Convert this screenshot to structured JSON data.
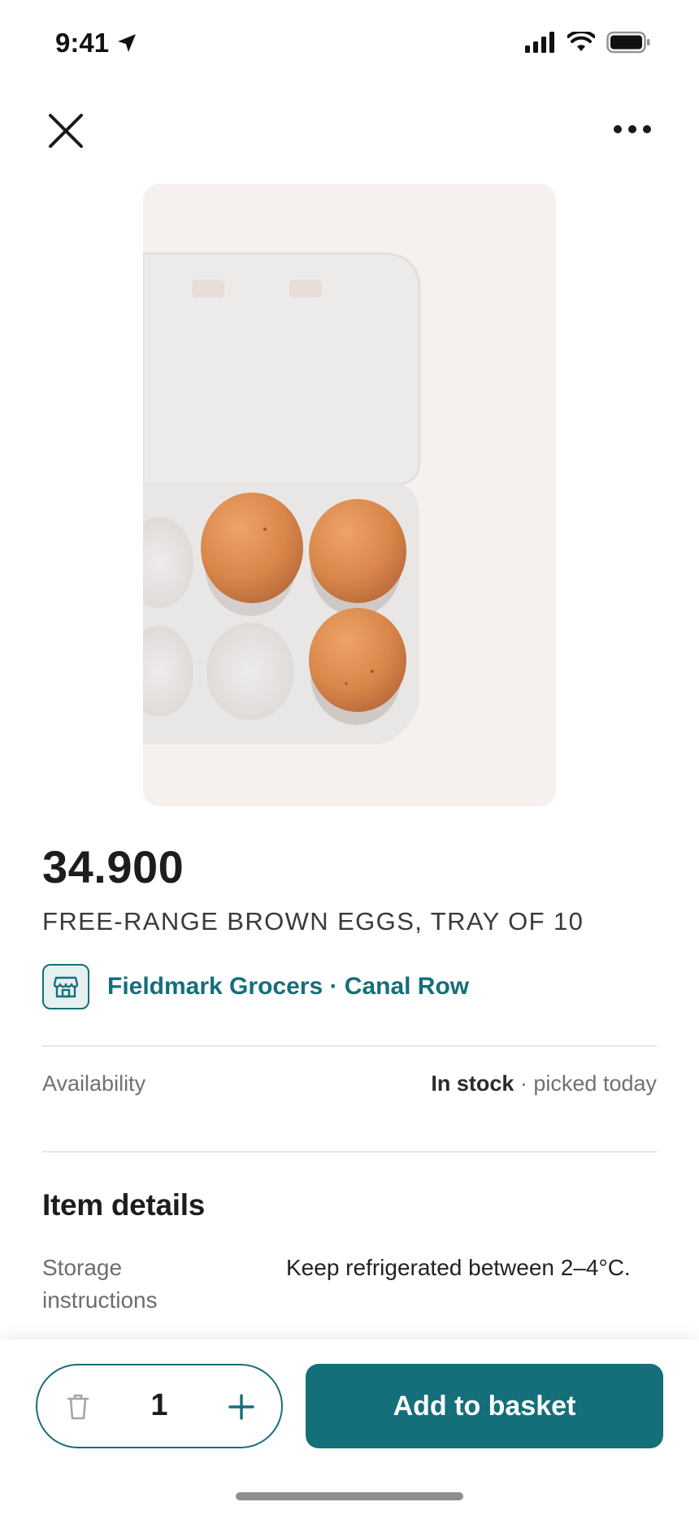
{
  "status_bar": {
    "time": "9:41"
  },
  "nav": {
    "close_icon": "close-icon",
    "more_icon": "more-horizontal-icon"
  },
  "product": {
    "image_subject": "egg carton",
    "price": "34.900",
    "title": "FREE-RANGE BROWN EGGS, TRAY OF 10",
    "store_name": "Fieldmark Grocers · Canal Row",
    "store_icon": "storefront-icon"
  },
  "availability": {
    "label": "Availability",
    "status": "In stock",
    "note": " · picked today"
  },
  "item_details": {
    "heading": "Item details",
    "rows": [
      {
        "key": "Storage instructions",
        "value": "Keep refrigerated between 2–4°C."
      }
    ]
  },
  "cart": {
    "quantity": "1",
    "delete_icon": "trash-icon",
    "plus_icon": "plus-icon",
    "add_label": "Add to basket"
  },
  "colors": {
    "accent": "#146f7a",
    "accent_light": "#e6f0f1"
  }
}
